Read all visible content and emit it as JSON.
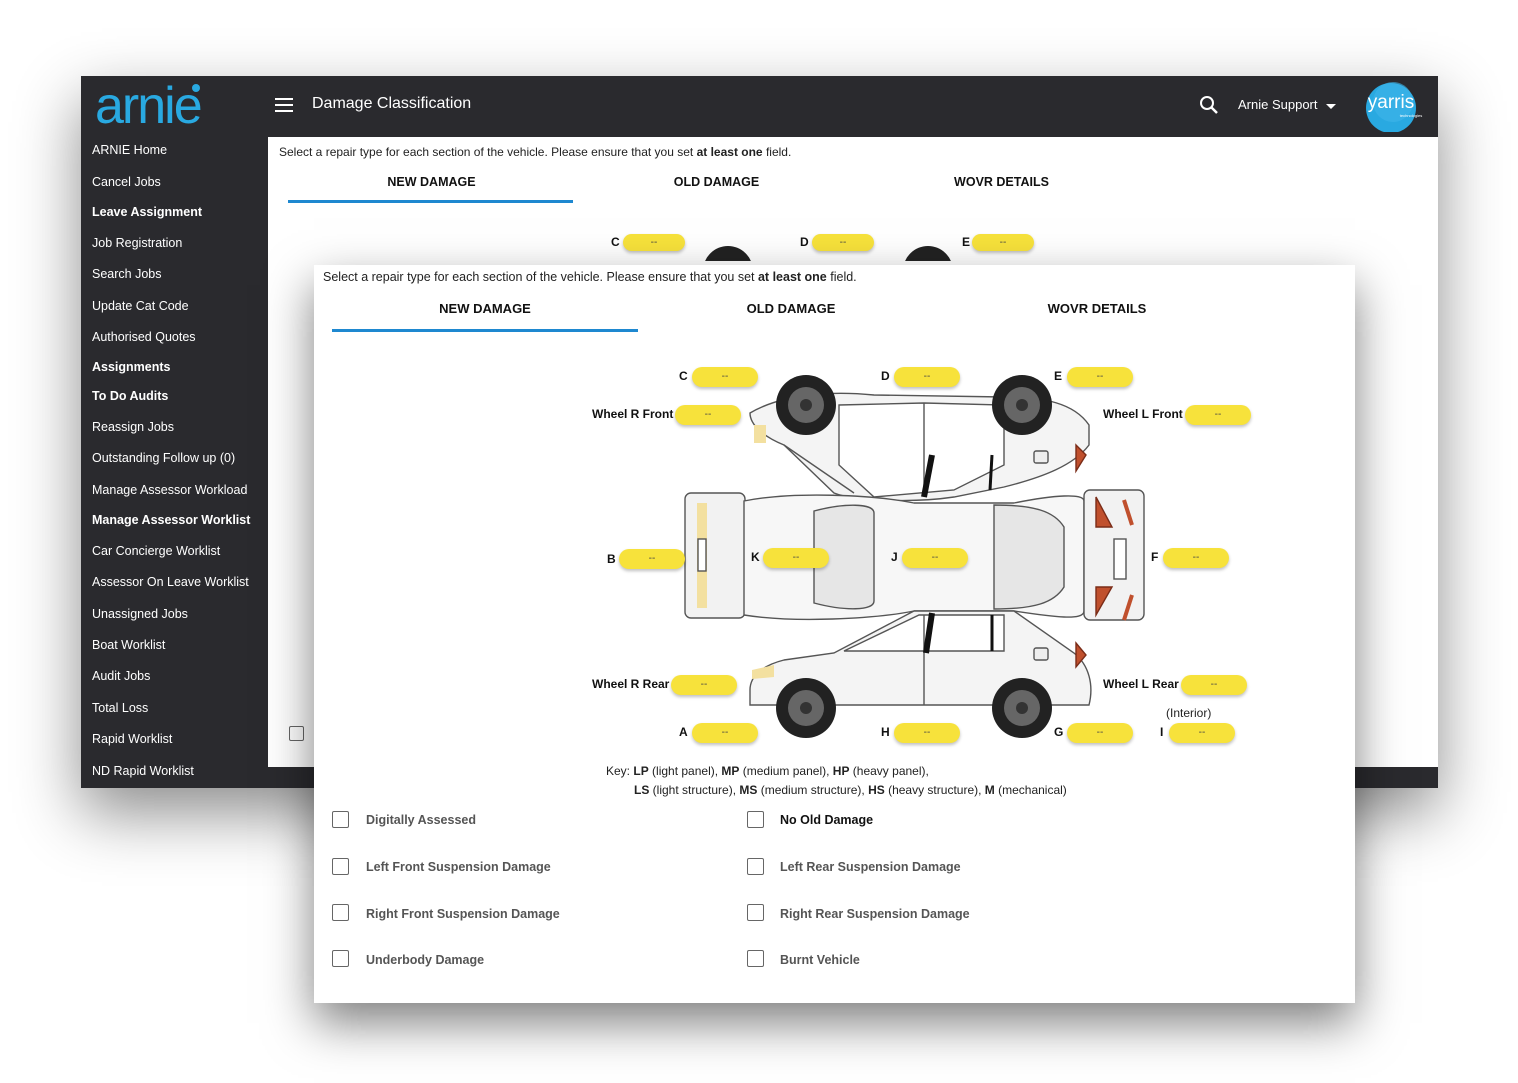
{
  "header": {
    "logo_text": "arnie",
    "title": "Damage Classification",
    "user": "Arnie Support",
    "partner_logo_text": "yarris",
    "partner_logo_sub": "technologies"
  },
  "sidebar": {
    "items": [
      {
        "label": "ARNIE Home",
        "bold": false
      },
      {
        "label": "Cancel Jobs",
        "bold": false
      },
      {
        "label": "Leave Assignment",
        "bold": true
      },
      {
        "label": "Job Registration",
        "bold": false
      },
      {
        "label": "Search Jobs",
        "bold": false
      },
      {
        "label": "Update Cat Code",
        "bold": false
      },
      {
        "label": "Authorised Quotes",
        "bold": false
      },
      {
        "label": "Assignments",
        "bold": true
      },
      {
        "label": "To Do Audits",
        "bold": true
      },
      {
        "label": "Reassign Jobs",
        "bold": false
      },
      {
        "label": "Outstanding Follow up (0)",
        "bold": false
      },
      {
        "label": "Manage Assessor Workload",
        "bold": false
      },
      {
        "label": "Manage Assessor Worklist",
        "bold": true
      },
      {
        "label": "Car Concierge Worklist",
        "bold": false
      },
      {
        "label": "Assessor On Leave Worklist",
        "bold": false
      },
      {
        "label": "Unassigned Jobs",
        "bold": false
      },
      {
        "label": "Boat Worklist",
        "bold": false
      },
      {
        "label": "Audit Jobs",
        "bold": false
      },
      {
        "label": "Total Loss",
        "bold": false
      },
      {
        "label": "Rapid Worklist",
        "bold": false
      },
      {
        "label": "ND Rapid Worklist",
        "bold": false
      }
    ]
  },
  "instructions": {
    "prefix": "Select a repair type for each section of the vehicle. Please ensure that you set ",
    "emphasis": "at least one",
    "suffix": " field."
  },
  "tabs": {
    "new_damage": "NEW DAMAGE",
    "old_damage": "OLD DAMAGE",
    "wovr_details": "WOVR DETAILS",
    "active": "NEW DAMAGE"
  },
  "sections": {
    "C": {
      "label": "C",
      "value": "--"
    },
    "D": {
      "label": "D",
      "value": "--"
    },
    "E": {
      "label": "E",
      "value": "--"
    },
    "wheel_r_front": {
      "label": "Wheel R Front",
      "value": "--"
    },
    "wheel_l_front": {
      "label": "Wheel L Front",
      "value": "--"
    },
    "B": {
      "label": "B",
      "value": "--"
    },
    "K": {
      "label": "K",
      "value": "--"
    },
    "J": {
      "label": "J",
      "value": "--"
    },
    "F": {
      "label": "F",
      "value": "--"
    },
    "wheel_r_rear": {
      "label": "Wheel R Rear",
      "value": "--"
    },
    "wheel_l_rear": {
      "label": "Wheel L Rear",
      "value": "--"
    },
    "A": {
      "label": "A",
      "value": "--"
    },
    "H": {
      "label": "H",
      "value": "--"
    },
    "G": {
      "label": "G",
      "value": "--"
    },
    "I": {
      "label": "I",
      "value": "--",
      "note": "(Interior)"
    }
  },
  "key": {
    "prefix": "Key: ",
    "line1": [
      {
        "code": "LP",
        "desc": " (light panel), "
      },
      {
        "code": "MP",
        "desc": " (medium panel), "
      },
      {
        "code": "HP",
        "desc": " (heavy panel),"
      }
    ],
    "line2": [
      {
        "code": "LS",
        "desc": " (light structure), "
      },
      {
        "code": "MS",
        "desc": " (medium structure), "
      },
      {
        "code": "HS",
        "desc": " (heavy structure), "
      },
      {
        "code": "M",
        "desc": " (mechanical)"
      }
    ]
  },
  "checkboxes": {
    "digitally_assessed": {
      "label": "Digitally Assessed",
      "checked": false
    },
    "no_old_damage": {
      "label": "No Old Damage",
      "checked": false
    },
    "left_front_susp": {
      "label": "Left Front Suspension Damage",
      "checked": false
    },
    "left_rear_susp": {
      "label": "Left Rear Suspension Damage",
      "checked": false
    },
    "right_front_susp": {
      "label": "Right Front Suspension Damage",
      "checked": false
    },
    "right_rear_susp": {
      "label": "Right Rear Suspension Damage",
      "checked": false
    },
    "underbody": {
      "label": "Underbody Damage",
      "checked": false
    },
    "burnt_vehicle": {
      "label": "Burnt Vehicle",
      "checked": false
    }
  },
  "colors": {
    "app_bar": "#2a2a2e",
    "accent": "#1e88d0",
    "pill": "#f7e23b",
    "logo_blue": "#29a9e1"
  }
}
